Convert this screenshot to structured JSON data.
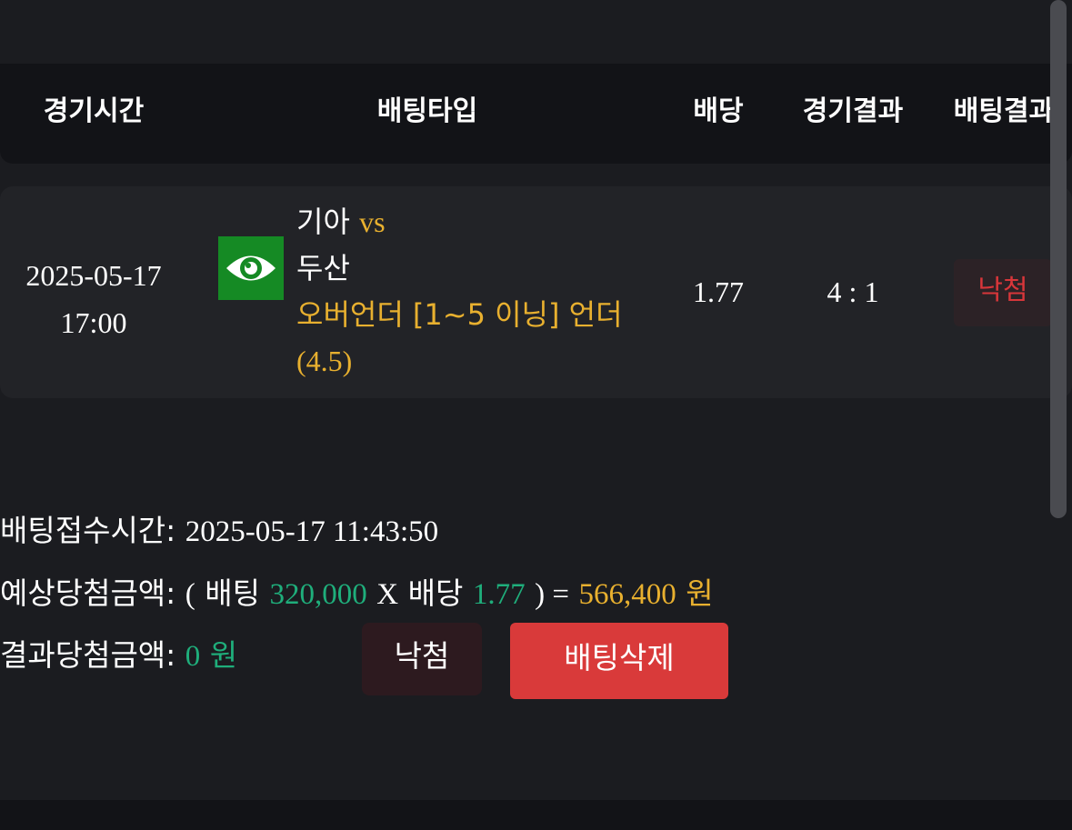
{
  "table": {
    "headers": [
      "경기시간",
      "배팅타입",
      "배당",
      "경기결과",
      "배팅결과"
    ]
  },
  "row": {
    "date": "2025-05-17",
    "time": "17:00",
    "game_icon": "eye-icon",
    "home_team": "기아",
    "vs": "vs",
    "away_team": "두산",
    "bet_type": "오버언더 [1~5 이닝] 언더",
    "bet_line": "(4.5)",
    "odds": "1.77",
    "score": "4 : 1",
    "result": "낙첨"
  },
  "summary": {
    "received_label": "배팅접수시간:",
    "received_time": "2025-05-17 11:43:50",
    "expected_label": "예상당첨금액:",
    "open_paren": "(",
    "bet_word": "배팅",
    "bet_amount": "320,000",
    "multiply": "X",
    "odds_word": "배당",
    "odds_value": "1.77",
    "close_eq": ") =",
    "expected_amount": "566,400",
    "won_unit": "원",
    "result_label": "결과당첨금액:",
    "result_amount": "0",
    "result_unit": "원"
  },
  "buttons": {
    "status_label": "낙첨",
    "delete_label": "배팅삭제"
  },
  "colors": {
    "background": "#1b1c20",
    "header_bg": "#121317",
    "row_bg": "#222327",
    "gold": "#e8b02f",
    "green": "#1fae7b",
    "red": "#d93a3a",
    "icon_green": "#158a24"
  }
}
